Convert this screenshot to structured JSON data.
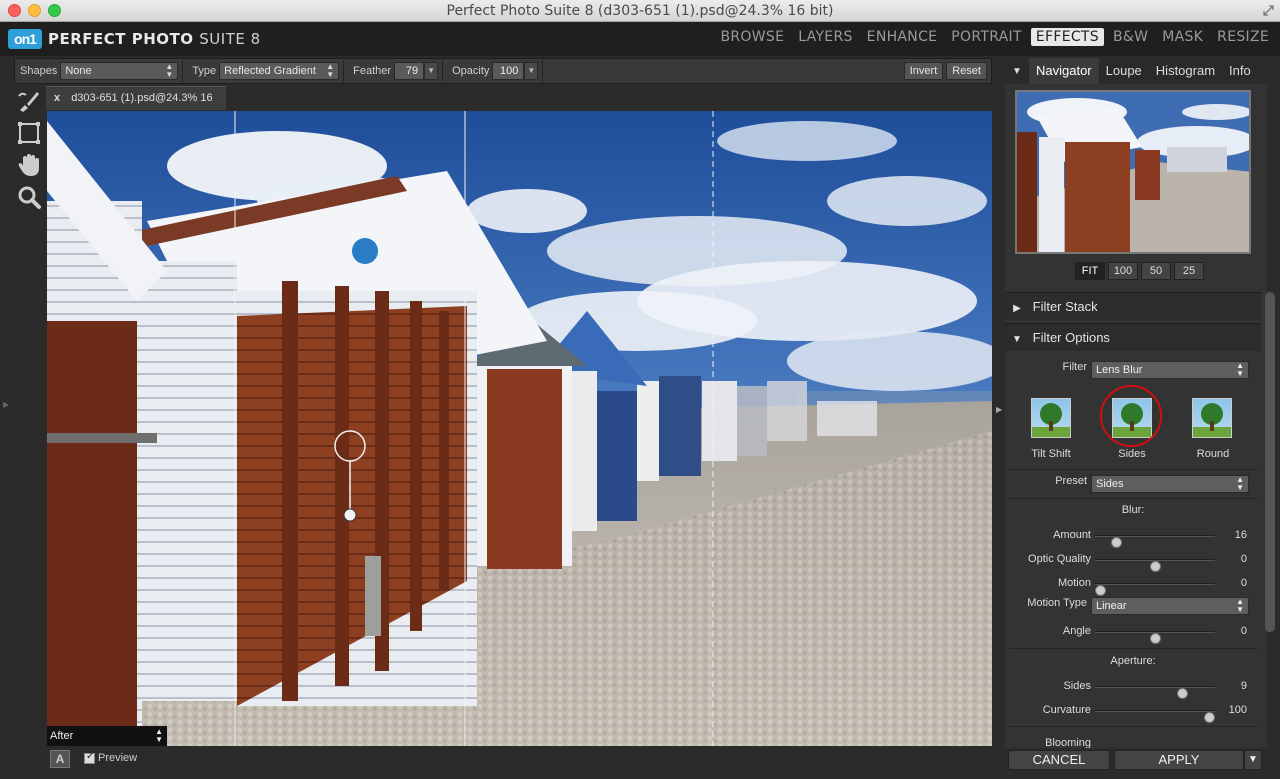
{
  "window": {
    "title": "Perfect Photo Suite 8 (d303-651 (1).psd@24.3% 16 bit)"
  },
  "app": {
    "logo_mark": "on1",
    "brand_bold": "PERFECT PHOTO",
    "brand_thin": "SUITE 8"
  },
  "modules": [
    "BROWSE",
    "LAYERS",
    "ENHANCE",
    "PORTRAIT",
    "EFFECTS",
    "B&W",
    "MASK",
    "RESIZE"
  ],
  "active_module": "EFFECTS",
  "toolbar": {
    "shapes_label": "Shapes",
    "shapes_value": "None",
    "type_label": "Type",
    "type_value": "Reflected Gradient",
    "feather_label": "Feather",
    "feather_value": "79",
    "opacity_label": "Opacity",
    "opacity_value": "100",
    "invert_label": "Invert",
    "reset_label": "Reset"
  },
  "tools": [
    "brush-tool-icon",
    "crop-tool-icon",
    "hand-tool-icon",
    "zoom-tool-icon"
  ],
  "document": {
    "close": "x",
    "tab_name": "d303-651 (1).psd@24.3% 16 bit"
  },
  "view": {
    "mode": "After",
    "a_label": "A",
    "preview_label": "Preview"
  },
  "panel": {
    "tabs": [
      "Navigator",
      "Loupe",
      "Histogram",
      "Info"
    ],
    "zoom": [
      "FIT",
      "100",
      "50",
      "25"
    ],
    "filter_stack": "Filter Stack",
    "filter_options": "Filter Options",
    "filter_label": "Filter",
    "filter_value": "Lens Blur",
    "presets": [
      "Tilt Shift",
      "Sides",
      "Round"
    ],
    "preset_label": "Preset",
    "preset_value": "Sides",
    "blur_heading": "Blur:",
    "amount_label": "Amount",
    "amount_value": "16",
    "amount_level": 0.15,
    "optic_label": "Optic Quality",
    "optic_value": "0",
    "optic_level": 0.5,
    "motion_label": "Motion",
    "motion_value": "0",
    "motion_level": 0.0,
    "motion_type_label": "Motion Type",
    "motion_type_value": "Linear",
    "angle_label": "Angle",
    "angle_value": "0",
    "angle_level": 0.5,
    "aperture_heading": "Aperture:",
    "sides_label": "Sides",
    "sides_value": "9",
    "sides_level": 0.75,
    "curvature_label": "Curvature",
    "curvature_value": "100",
    "curvature_level": 1.0,
    "blooming_label": "Blooming"
  },
  "actions": {
    "cancel": "CANCEL",
    "apply": "APPLY"
  }
}
